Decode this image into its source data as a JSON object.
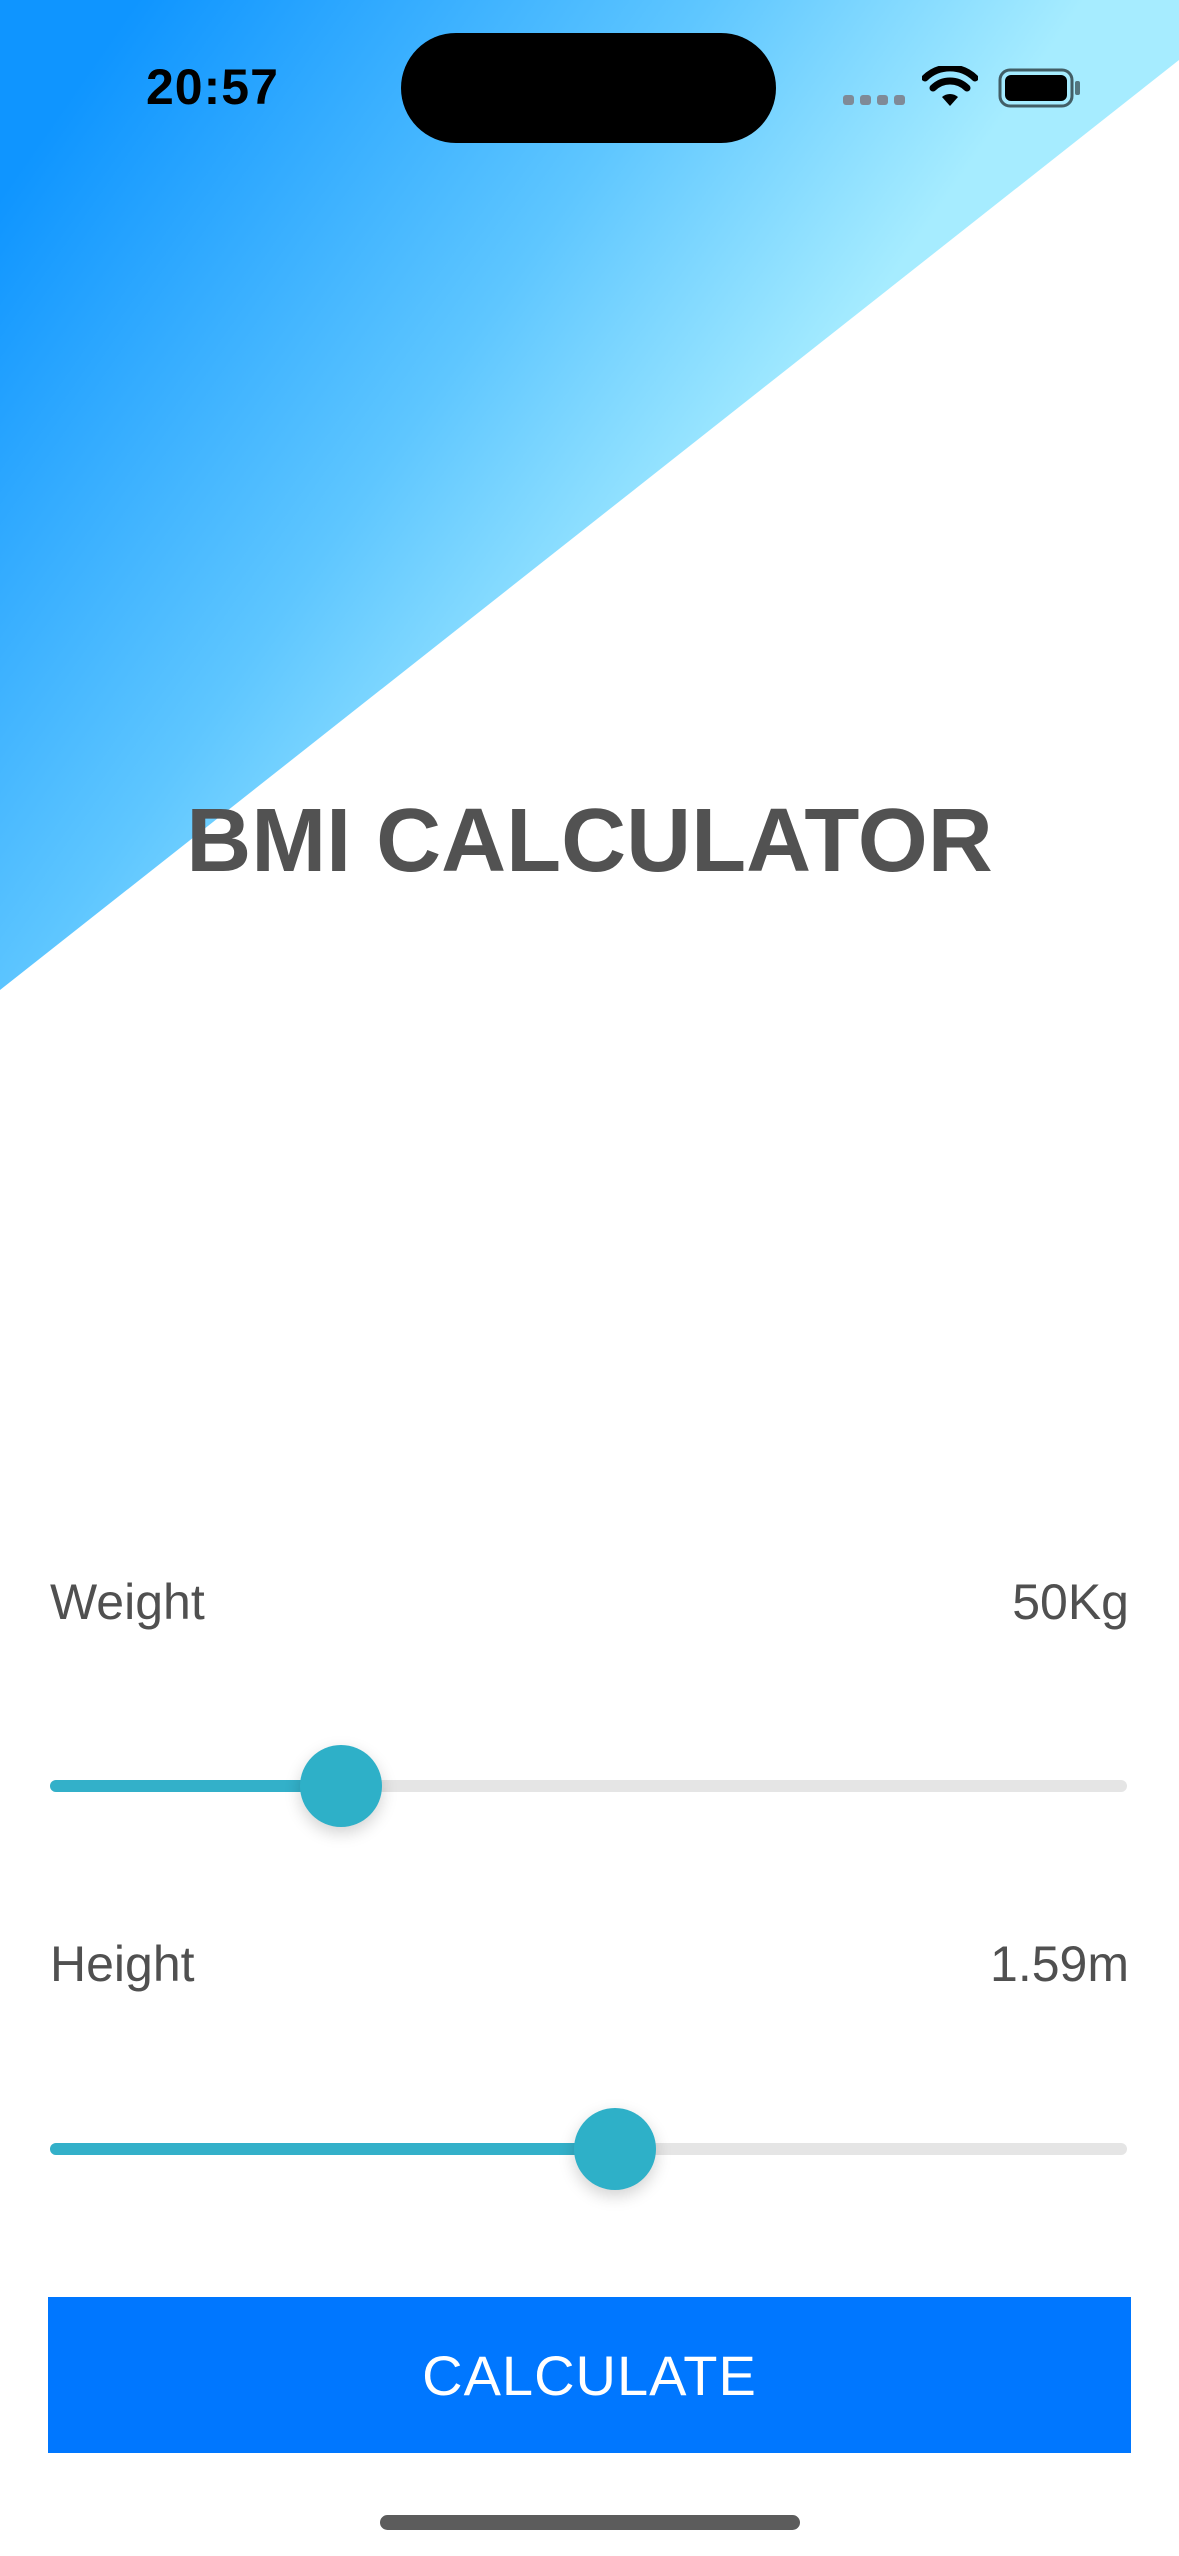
{
  "status_bar": {
    "time": "20:57"
  },
  "app": {
    "title": "BMI CALCULATOR"
  },
  "weight": {
    "label": "Weight",
    "value_text": "50Kg",
    "slider_fraction": 0.27
  },
  "height": {
    "label": "Height",
    "value_text": "1.59m",
    "slider_fraction": 0.525
  },
  "button": {
    "label": "CALCULATE"
  },
  "colors": {
    "gradient_start": "#0f95ff",
    "gradient_end": "#a6ecff",
    "slider_accent": "#2eb0c8",
    "button_bg": "#0077ff",
    "text": "#525252"
  }
}
